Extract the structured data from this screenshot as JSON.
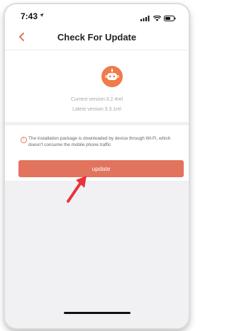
{
  "status_bar": {
    "time": "7:43"
  },
  "nav": {
    "title": "Check For Update"
  },
  "versions": {
    "current": "Current version:3.2.4rel",
    "latest": "Latest version:3.3.1rel"
  },
  "notice": {
    "text": "The installation package is downloaded by device through Wi-Fi, which doesn't consume the mobile phone traffic"
  },
  "actions": {
    "update_label": "update"
  },
  "colors": {
    "accent": "#e2735c",
    "robot": "#f07a4a",
    "annotation_arrow": "#e8333b"
  },
  "icons": [
    "location-arrow-icon",
    "signal-icon",
    "wifi-icon",
    "battery-icon",
    "back-chevron-icon",
    "robot-icon",
    "info-circle-icon"
  ]
}
